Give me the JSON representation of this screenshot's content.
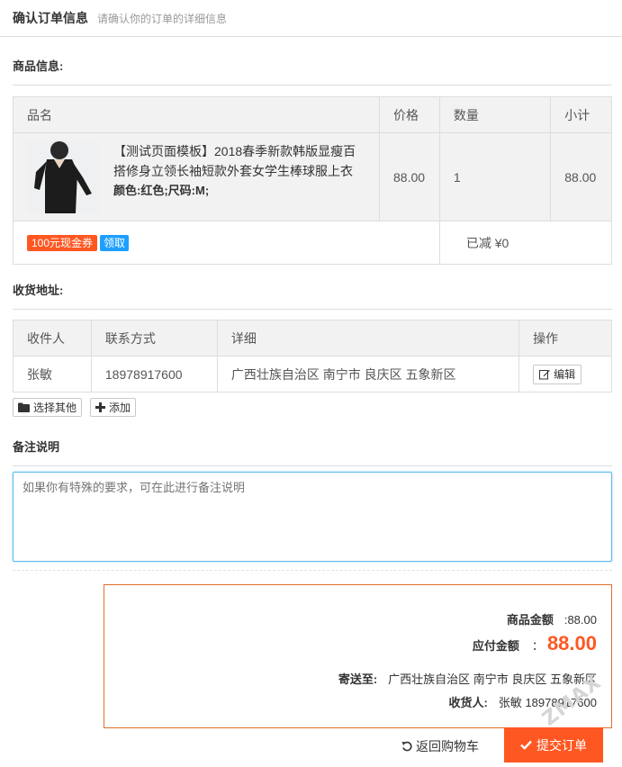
{
  "header": {
    "title": "确认订单信息",
    "subtitle": "请确认你的订单的详细信息"
  },
  "goods": {
    "section_title": "商品信息:",
    "columns": [
      "品名",
      "价格",
      "数量",
      "小计"
    ],
    "item": {
      "name": "【测试页面模板】2018春季新款韩版显瘦百搭修身立领长袖短款外套女学生棒球服上衣",
      "spec": "颜色:红色;尺码:M;",
      "price": "88.00",
      "quantity": "1",
      "subtotal": "88.00"
    },
    "coupon_label": "100元现金券",
    "coupon_get_label": "领取",
    "discount_text": "已减 ¥0"
  },
  "address": {
    "section_title": "收货地址:",
    "columns": [
      "收件人",
      "联系方式",
      "详细",
      "操作"
    ],
    "row": {
      "name": "张敏",
      "phone": "18978917600",
      "detail": "广西壮族自治区 南宁市 良庆区 五象新区",
      "edit_label": "编辑"
    },
    "select_other_label": "选择其他",
    "add_label": "添加"
  },
  "remark": {
    "section_title": "备注说明",
    "placeholder": "如果你有特殊的要求，可在此进行备注说明"
  },
  "summary": {
    "goods_amount_label": "商品金额",
    "goods_amount_value": ":88.00",
    "payable_label": "应付金额",
    "payable_colon": "：",
    "payable_value": "88.00",
    "ship_to_label": "寄送至:",
    "ship_to_value": "广西壮族自治区 南宁市 良庆区 五象新区",
    "receiver_label": "收货人:",
    "receiver_value": "张敏 18978917600"
  },
  "footer": {
    "back_label": "返回购物车",
    "submit_label": "提交订单"
  },
  "watermark": "ZMAX",
  "colors": {
    "accent": "#ff5722",
    "link_blue": "#1e9fff",
    "border_orange": "#e0702a"
  }
}
